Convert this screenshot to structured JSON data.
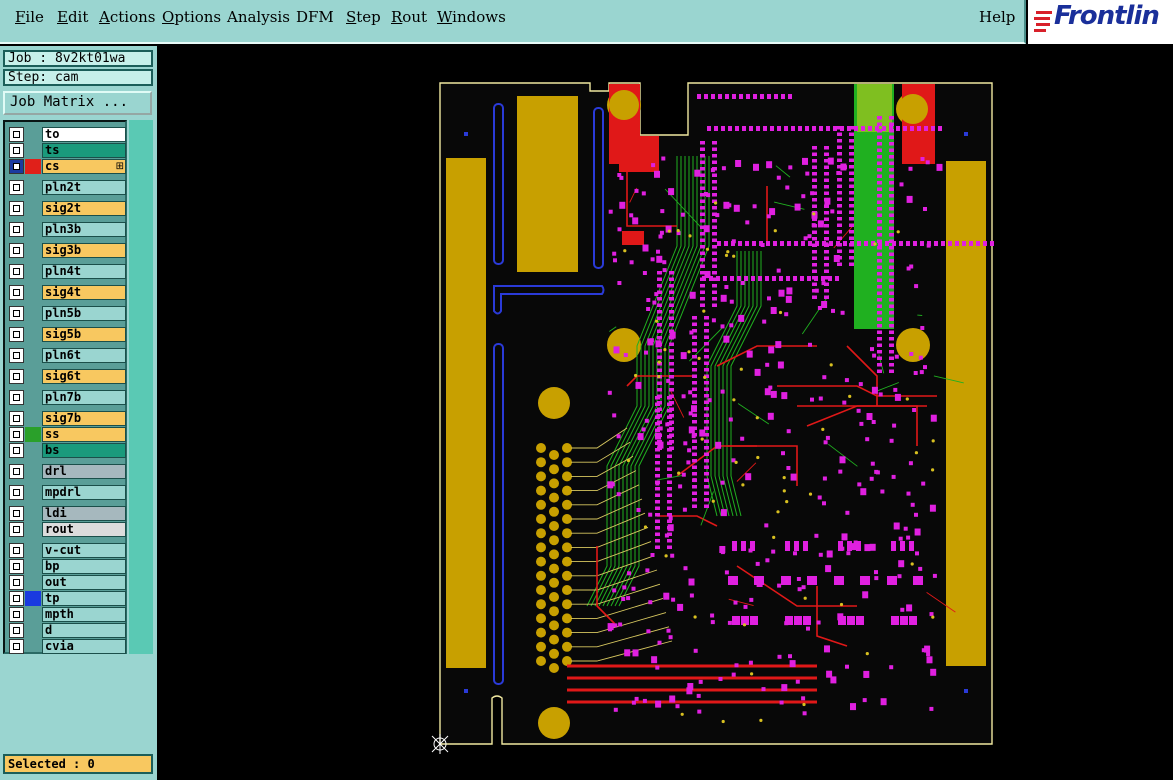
{
  "menubar": {
    "items": [
      {
        "label": "File",
        "underline": "F",
        "rest": "ile"
      },
      {
        "label": "Edit",
        "underline": "E",
        "rest": "dit"
      },
      {
        "label": "Actions",
        "underline": "A",
        "rest": "ctions"
      },
      {
        "label": "Options",
        "underline": "O",
        "rest": "ptions"
      },
      {
        "label": "Analysis",
        "underline": "",
        "rest": "Analysis"
      },
      {
        "label": "DFM",
        "underline": "",
        "rest": "DFM"
      },
      {
        "label": "Step",
        "underline": "S",
        "rest": "tep"
      },
      {
        "label": "Rout",
        "underline": "R",
        "rest": "out"
      },
      {
        "label": "Windows",
        "underline": "W",
        "rest": "indows"
      }
    ],
    "help": "Help"
  },
  "logo": {
    "text": "Frontlin",
    "color": "#1a2f9a",
    "mark_color": "#d8202a"
  },
  "job": {
    "label": "Job : 8v2kt01wa"
  },
  "step": {
    "label": "Step: cam"
  },
  "matrix_button": {
    "label": "Job Matrix ..."
  },
  "layers": [
    {
      "name": "to",
      "color": "#ffffff",
      "swatch": ""
    },
    {
      "name": "ts",
      "color": "#1a9a7c",
      "swatch": ""
    },
    {
      "name": "cs",
      "color": "#f8c860",
      "swatch": "#e0201a",
      "active": true,
      "marker": "⊞"
    },
    {
      "name": "pln2t",
      "color": "#9ad5d0",
      "swatch": ""
    },
    {
      "name": "sig2t",
      "color": "#f8c860",
      "swatch": ""
    },
    {
      "name": "pln3b",
      "color": "#9ad5d0",
      "swatch": ""
    },
    {
      "name": "sig3b",
      "color": "#f8c860",
      "swatch": ""
    },
    {
      "name": "pln4t",
      "color": "#9ad5d0",
      "swatch": ""
    },
    {
      "name": "sig4t",
      "color": "#f8c860",
      "swatch": ""
    },
    {
      "name": "pln5b",
      "color": "#9ad5d0",
      "swatch": ""
    },
    {
      "name": "sig5b",
      "color": "#f8c860",
      "swatch": ""
    },
    {
      "name": "pln6t",
      "color": "#9ad5d0",
      "swatch": ""
    },
    {
      "name": "sig6t",
      "color": "#f8c860",
      "swatch": ""
    },
    {
      "name": "pln7b",
      "color": "#9ad5d0",
      "swatch": ""
    },
    {
      "name": "sig7b",
      "color": "#f8c860",
      "swatch": ""
    },
    {
      "name": "ss",
      "color": "#f8c860",
      "swatch": "#2aa02a"
    },
    {
      "name": "bs",
      "color": "#1a9a7c",
      "swatch": ""
    },
    {
      "name": "drl",
      "color": "#a6b8be",
      "swatch": ""
    },
    {
      "name": "mpdrl",
      "color": "#9ad5d0",
      "swatch": ""
    },
    {
      "name": "ldi",
      "color": "#a6b8be",
      "swatch": ""
    },
    {
      "name": "rout",
      "color": "#dcdcdc",
      "swatch": ""
    },
    {
      "name": "v-cut",
      "color": "#9ad5d0",
      "swatch": ""
    },
    {
      "name": "bp",
      "color": "#9ad5d0",
      "swatch": ""
    },
    {
      "name": "out",
      "color": "#9ad5d0",
      "swatch": ""
    },
    {
      "name": "tp",
      "color": "#9ad5d0",
      "swatch": "#1a3ae0"
    },
    {
      "name": "mpth",
      "color": "#9ad5d0",
      "swatch": ""
    },
    {
      "name": "d",
      "color": "#9ad5d0",
      "swatch": ""
    },
    {
      "name": "cvia",
      "color": "#9ad5d0",
      "swatch": ""
    }
  ],
  "status": {
    "selected": "Selected : 0"
  },
  "board_colors": {
    "copper": "#c8a000",
    "pad": "#e020e0",
    "trace_red": "#e01818",
    "trace_green": "#20b020",
    "slot": "#2a3ad8",
    "outline": "#f0e8a0"
  }
}
